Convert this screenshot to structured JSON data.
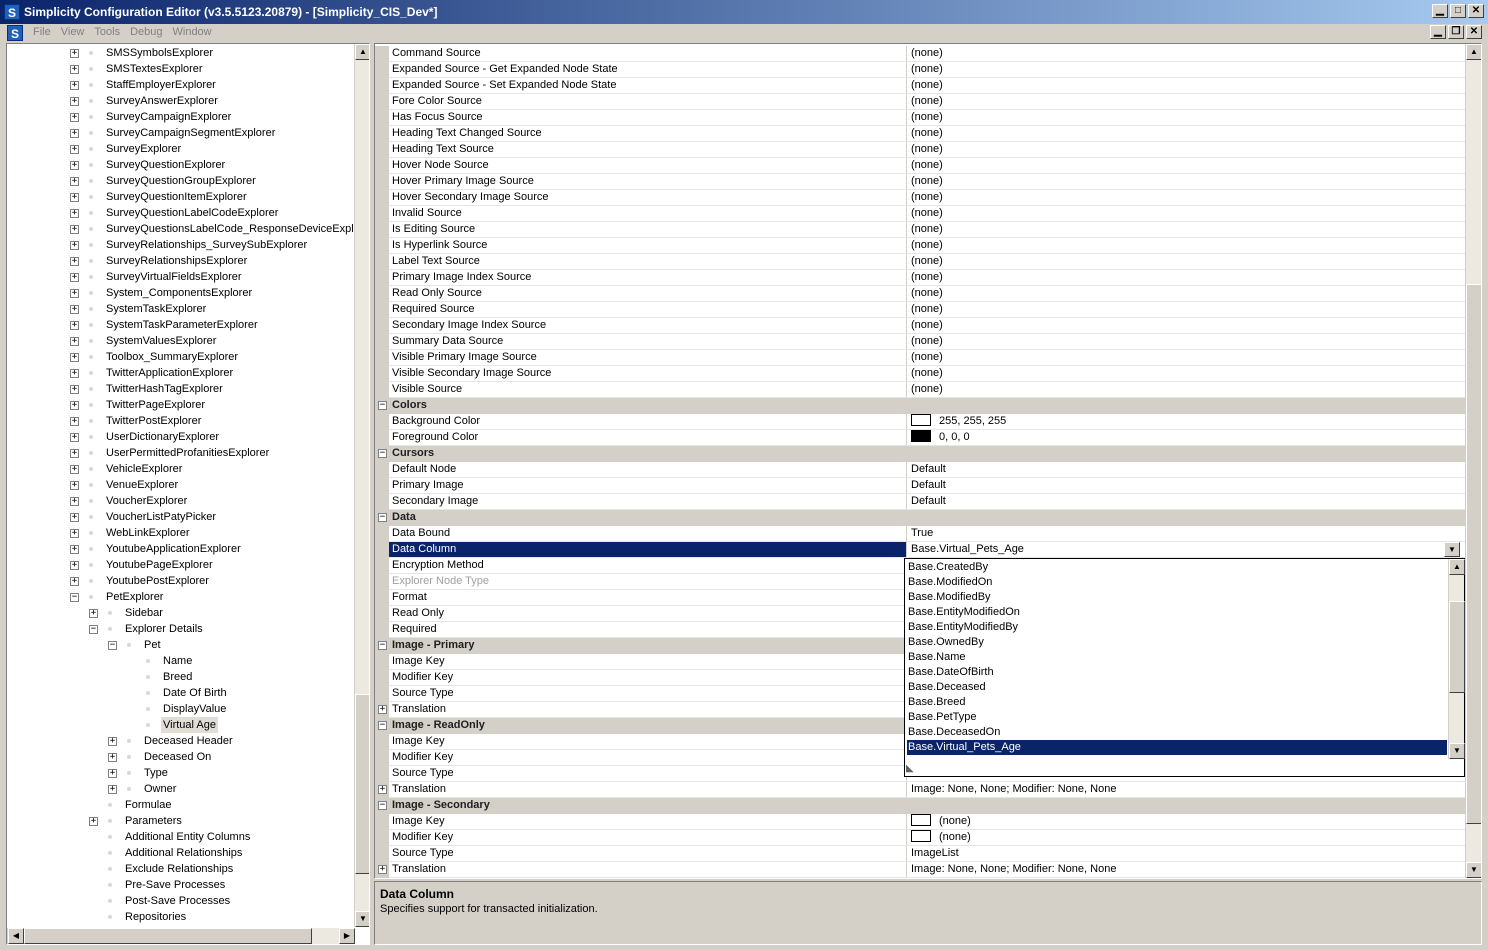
{
  "window": {
    "title": "Simplicity Configuration Editor (v3.5.5123.20879) - [Simplicity_CIS_Dev*]",
    "app_icon": "S",
    "minimize": "▁",
    "maximize": "□",
    "close": "✕"
  },
  "menu": {
    "items": [
      "File",
      "View",
      "Tools",
      "Debug",
      "Window"
    ],
    "restore": "❐"
  },
  "tree": {
    "rows": [
      {
        "label": "SMSSymbolsExplorer",
        "level": 0,
        "pm": "+"
      },
      {
        "label": "SMSTextesExplorer",
        "level": 0,
        "pm": "+"
      },
      {
        "label": "StaffEmployerExplorer",
        "level": 0,
        "pm": "+"
      },
      {
        "label": "SurveyAnswerExplorer",
        "level": 0,
        "pm": "+"
      },
      {
        "label": "SurveyCampaignExplorer",
        "level": 0,
        "pm": "+"
      },
      {
        "label": "SurveyCampaignSegmentExplorer",
        "level": 0,
        "pm": "+"
      },
      {
        "label": "SurveyExplorer",
        "level": 0,
        "pm": "+"
      },
      {
        "label": "SurveyQuestionExplorer",
        "level": 0,
        "pm": "+"
      },
      {
        "label": "SurveyQuestionGroupExplorer",
        "level": 0,
        "pm": "+"
      },
      {
        "label": "SurveyQuestionItemExplorer",
        "level": 0,
        "pm": "+"
      },
      {
        "label": "SurveyQuestionLabelCodeExplorer",
        "level": 0,
        "pm": "+"
      },
      {
        "label": "SurveyQuestionsLabelCode_ResponseDeviceExplor",
        "level": 0,
        "pm": "+"
      },
      {
        "label": "SurveyRelationships_SurveySubExplorer",
        "level": 0,
        "pm": "+"
      },
      {
        "label": "SurveyRelationshipsExplorer",
        "level": 0,
        "pm": "+"
      },
      {
        "label": "SurveyVirtualFieldsExplorer",
        "level": 0,
        "pm": "+"
      },
      {
        "label": "System_ComponentsExplorer",
        "level": 0,
        "pm": "+"
      },
      {
        "label": "SystemTaskExplorer",
        "level": 0,
        "pm": "+"
      },
      {
        "label": "SystemTaskParameterExplorer",
        "level": 0,
        "pm": "+"
      },
      {
        "label": "SystemValuesExplorer",
        "level": 0,
        "pm": "+"
      },
      {
        "label": "Toolbox_SummaryExplorer",
        "level": 0,
        "pm": "+"
      },
      {
        "label": "TwitterApplicationExplorer",
        "level": 0,
        "pm": "+"
      },
      {
        "label": "TwitterHashTagExplorer",
        "level": 0,
        "pm": "+"
      },
      {
        "label": "TwitterPageExplorer",
        "level": 0,
        "pm": "+"
      },
      {
        "label": "TwitterPostExplorer",
        "level": 0,
        "pm": "+"
      },
      {
        "label": "UserDictionaryExplorer",
        "level": 0,
        "pm": "+"
      },
      {
        "label": "UserPermittedProfanitiesExplorer",
        "level": 0,
        "pm": "+"
      },
      {
        "label": "VehicleExplorer",
        "level": 0,
        "pm": "+"
      },
      {
        "label": "VenueExplorer",
        "level": 0,
        "pm": "+"
      },
      {
        "label": "VoucherExplorer",
        "level": 0,
        "pm": "+"
      },
      {
        "label": "VoucherListPatyPicker",
        "level": 0,
        "pm": "+"
      },
      {
        "label": "WebLinkExplorer",
        "level": 0,
        "pm": "+"
      },
      {
        "label": "YoutubeApplicationExplorer",
        "level": 0,
        "pm": "+"
      },
      {
        "label": "YoutubePageExplorer",
        "level": 0,
        "pm": "+"
      },
      {
        "label": "YoutubePostExplorer",
        "level": 0,
        "pm": "+"
      },
      {
        "label": "PetExplorer",
        "level": 0,
        "pm": "−"
      },
      {
        "label": "Sidebar",
        "level": 1,
        "pm": "+"
      },
      {
        "label": "Explorer Details",
        "level": 1,
        "pm": "−"
      },
      {
        "label": "Pet",
        "level": 2,
        "pm": "−"
      },
      {
        "label": "Name",
        "level": 3,
        "pm": ""
      },
      {
        "label": "Breed",
        "level": 3,
        "pm": ""
      },
      {
        "label": "Date Of Birth",
        "level": 3,
        "pm": ""
      },
      {
        "label": "DisplayValue",
        "level": 3,
        "pm": ""
      },
      {
        "label": "Virtual Age",
        "level": 3,
        "pm": "",
        "selected": true
      },
      {
        "label": "Deceased Header",
        "level": 2,
        "pm": "+"
      },
      {
        "label": "Deceased On",
        "level": 2,
        "pm": "+"
      },
      {
        "label": "Type",
        "level": 2,
        "pm": "+"
      },
      {
        "label": "Owner",
        "level": 2,
        "pm": "+"
      },
      {
        "label": "Formulae",
        "level": 1,
        "pm": ""
      },
      {
        "label": "Parameters",
        "level": 1,
        "pm": "+"
      },
      {
        "label": "Additional Entity Columns",
        "level": 1,
        "pm": ""
      },
      {
        "label": "Additional Relationships",
        "level": 1,
        "pm": ""
      },
      {
        "label": "Exclude Relationships",
        "level": 1,
        "pm": ""
      },
      {
        "label": "Pre-Save Processes",
        "level": 1,
        "pm": ""
      },
      {
        "label": "Post-Save Processes",
        "level": 1,
        "pm": ""
      },
      {
        "label": "Repositories",
        "level": 1,
        "pm": ""
      }
    ]
  },
  "grid": {
    "rows": [
      {
        "type": "prop",
        "name": "Command Source",
        "value": "(none)"
      },
      {
        "type": "prop",
        "name": "Expanded Source - Get Expanded Node State",
        "value": "(none)"
      },
      {
        "type": "prop",
        "name": "Expanded Source - Set Expanded Node State",
        "value": "(none)"
      },
      {
        "type": "prop",
        "name": "Fore Color Source",
        "value": "(none)"
      },
      {
        "type": "prop",
        "name": "Has Focus Source",
        "value": "(none)"
      },
      {
        "type": "prop",
        "name": "Heading Text Changed Source",
        "value": "(none)"
      },
      {
        "type": "prop",
        "name": "Heading Text Source",
        "value": "(none)"
      },
      {
        "type": "prop",
        "name": "Hover Node Source",
        "value": "(none)"
      },
      {
        "type": "prop",
        "name": "Hover Primary Image Source",
        "value": "(none)"
      },
      {
        "type": "prop",
        "name": "Hover Secondary Image Source",
        "value": "(none)"
      },
      {
        "type": "prop",
        "name": "Invalid Source",
        "value": "(none)"
      },
      {
        "type": "prop",
        "name": "Is Editing Source",
        "value": "(none)"
      },
      {
        "type": "prop",
        "name": "Is Hyperlink Source",
        "value": "(none)"
      },
      {
        "type": "prop",
        "name": "Label Text Source",
        "value": "(none)"
      },
      {
        "type": "prop",
        "name": "Primary Image Index Source",
        "value": "(none)"
      },
      {
        "type": "prop",
        "name": "Read Only Source",
        "value": "(none)"
      },
      {
        "type": "prop",
        "name": "Required Source",
        "value": "(none)"
      },
      {
        "type": "prop",
        "name": "Secondary Image Index Source",
        "value": "(none)"
      },
      {
        "type": "prop",
        "name": "Summary Data Source",
        "value": "(none)"
      },
      {
        "type": "prop",
        "name": "Visible Primary Image Source",
        "value": "(none)"
      },
      {
        "type": "prop",
        "name": "Visible Secondary Image Source",
        "value": "(none)"
      },
      {
        "type": "prop",
        "name": "Visible Source",
        "value": "(none)"
      },
      {
        "type": "cat",
        "name": "Colors"
      },
      {
        "type": "prop",
        "name": "Background Color",
        "value": "255, 255, 255",
        "swatch": "#ffffff"
      },
      {
        "type": "prop",
        "name": "Foreground Color",
        "value": "0, 0, 0",
        "swatch": "#000000"
      },
      {
        "type": "cat",
        "name": "Cursors"
      },
      {
        "type": "prop",
        "name": "Default Node",
        "value": "Default"
      },
      {
        "type": "prop",
        "name": "Primary Image",
        "value": "Default"
      },
      {
        "type": "prop",
        "name": "Secondary Image",
        "value": "Default"
      },
      {
        "type": "cat",
        "name": "Data"
      },
      {
        "type": "prop",
        "name": "Data Bound",
        "value": "True"
      },
      {
        "type": "prop",
        "name": "Data Column",
        "value": "Base.Virtual_Pets_Age",
        "selected": true
      },
      {
        "type": "prop",
        "name": "Encryption Method",
        "value": ""
      },
      {
        "type": "prop",
        "name": "Explorer Node Type",
        "value": "",
        "dim": true
      },
      {
        "type": "prop",
        "name": "Format",
        "value": ""
      },
      {
        "type": "prop",
        "name": "Read Only",
        "value": ""
      },
      {
        "type": "prop",
        "name": "Required",
        "value": ""
      },
      {
        "type": "cat",
        "name": "Image - Primary"
      },
      {
        "type": "prop",
        "name": "Image Key",
        "value": ""
      },
      {
        "type": "prop",
        "name": "Modifier Key",
        "value": ""
      },
      {
        "type": "prop",
        "name": "Source Type",
        "value": ""
      },
      {
        "type": "prop",
        "name": "Translation",
        "value": "",
        "expand": true
      },
      {
        "type": "cat",
        "name": "Image - ReadOnly"
      },
      {
        "type": "prop",
        "name": "Image Key",
        "value": ""
      },
      {
        "type": "prop",
        "name": "Modifier Key",
        "value": ""
      },
      {
        "type": "prop",
        "name": "Source Type",
        "value": ""
      },
      {
        "type": "prop",
        "name": "Translation",
        "value": "Image: None, None; Modifier: None, None",
        "expand": true
      },
      {
        "type": "cat",
        "name": "Image - Secondary"
      },
      {
        "type": "prop",
        "name": "Image Key",
        "value": "(none)",
        "swatch": "#ffffff"
      },
      {
        "type": "prop",
        "name": "Modifier Key",
        "value": "(none)",
        "swatch": "#ffffff"
      },
      {
        "type": "prop",
        "name": "Source Type",
        "value": "ImageList"
      },
      {
        "type": "prop",
        "name": "Translation",
        "value": "Image: None, None; Modifier: None, None",
        "expand": true
      }
    ]
  },
  "dropdown": {
    "options": [
      "Base.CreatedBy",
      "Base.ModifiedOn",
      "Base.ModifiedBy",
      "Base.EntityModifiedOn",
      "Base.EntityModifiedBy",
      "Base.OwnedBy",
      "Base.Name",
      "Base.DateOfBirth",
      "Base.Deceased",
      "Base.Breed",
      "Base.PetType",
      "Base.DeceasedOn",
      "Base.Virtual_Pets_Age"
    ],
    "selected": "Base.Virtual_Pets_Age"
  },
  "help": {
    "title": "Data Column",
    "description": "Specifies support for transacted initialization."
  },
  "colors": {
    "title_bar": "#0a246a",
    "selection": "#0a246a",
    "face": "#d4d0c8"
  }
}
